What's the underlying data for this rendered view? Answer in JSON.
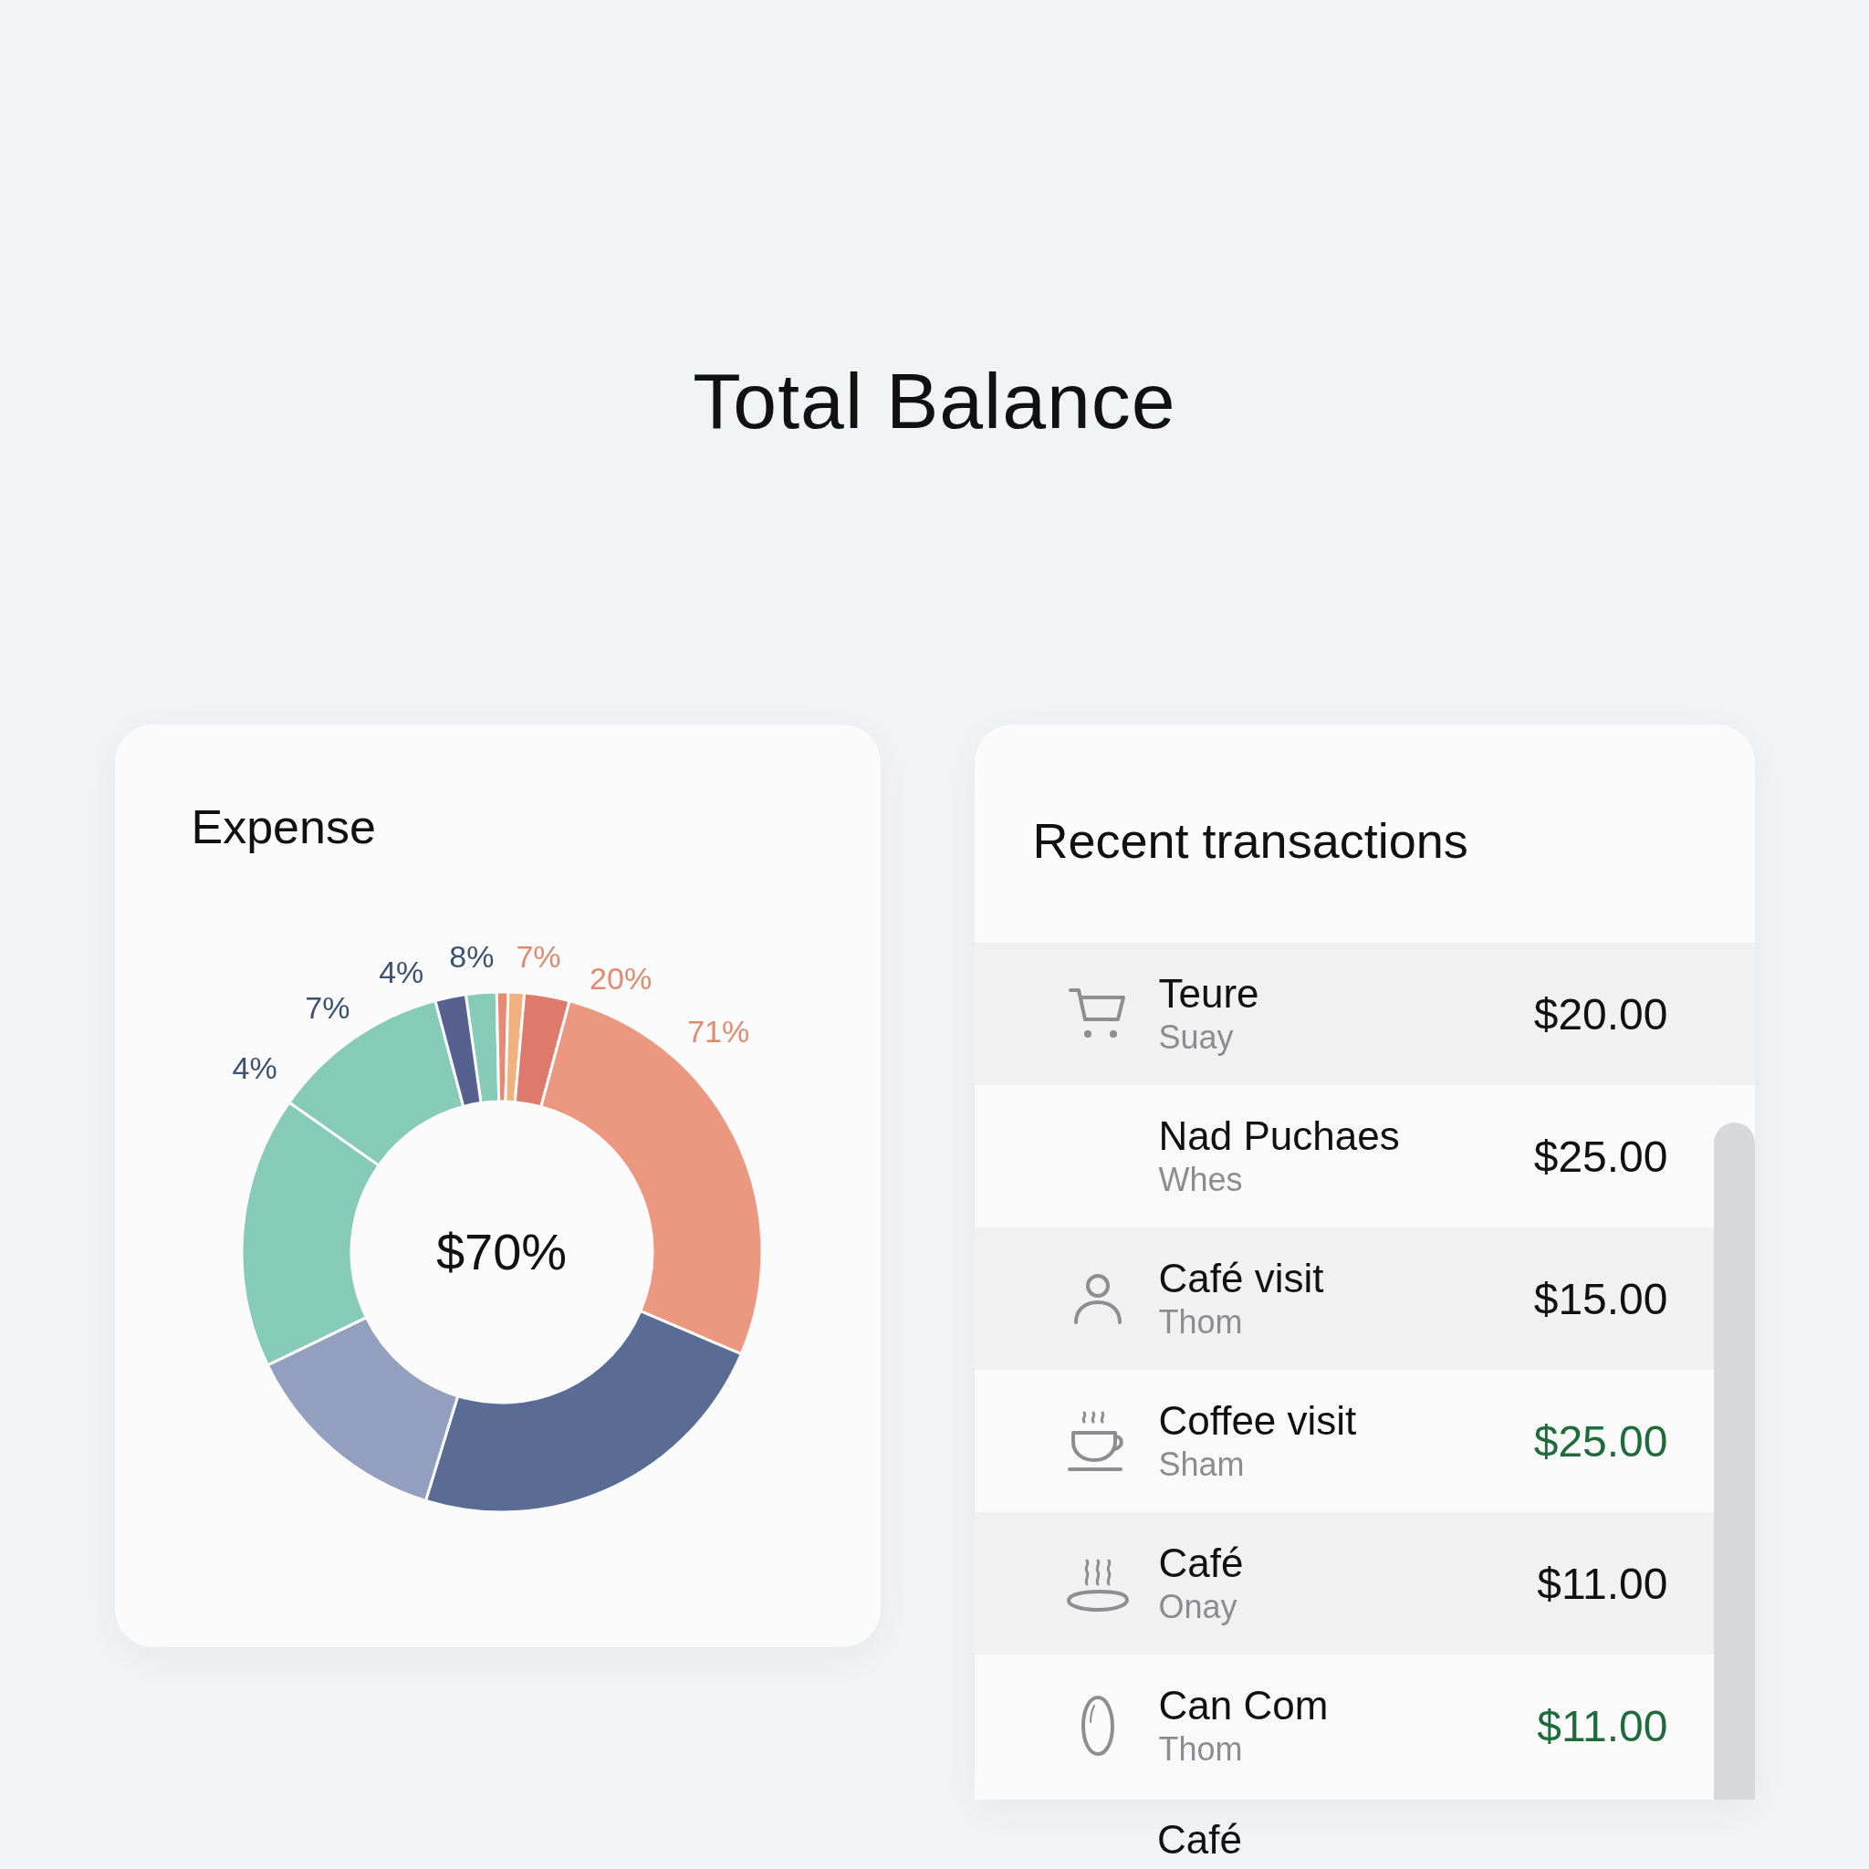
{
  "title": "Total Balance",
  "expense": {
    "title": "Expense",
    "center_text": "$70%",
    "chart_data": {
      "type": "donut",
      "values": [
        1.9,
        0.7,
        1.0,
        2.8,
        27.2,
        23.3,
        13.1,
        16.9,
        11.1,
        1.9
      ],
      "colors": [
        "#86cbb7",
        "#e88a73",
        "#f2b27e",
        "#de7a6c",
        "#ec9880",
        "#5a6b94",
        "#929fbf",
        "#86cbb7",
        "#86cbb7",
        "#56618f"
      ],
      "annotations": [
        "4%",
        "7%",
        "4%",
        "8%",
        "7%",
        "20%",
        "71%"
      ]
    }
  },
  "transactions": {
    "title": "Recent transactions",
    "rows": [
      {
        "kind": "cart",
        "name": "Teure",
        "sub": "Suay",
        "amount": "$20.00",
        "positive": false
      },
      {
        "kind": "plain",
        "name": "Nad Puchaes",
        "sub": "Whes",
        "amount": "$25.00",
        "positive": false
      },
      {
        "kind": "person",
        "name": "Café visit",
        "sub": "Thom",
        "amount": "$15.00",
        "positive": false
      },
      {
        "kind": "cup",
        "name": "Coffee visit",
        "sub": "Sham",
        "amount": "$25.00",
        "positive": true
      },
      {
        "kind": "dish",
        "name": "Café",
        "sub": "Onay",
        "amount": "$11.00",
        "positive": false
      },
      {
        "kind": "bean",
        "name": "Can Com",
        "sub": "Thom",
        "amount": "$11.00",
        "positive": true
      }
    ],
    "next_item": "Café"
  }
}
